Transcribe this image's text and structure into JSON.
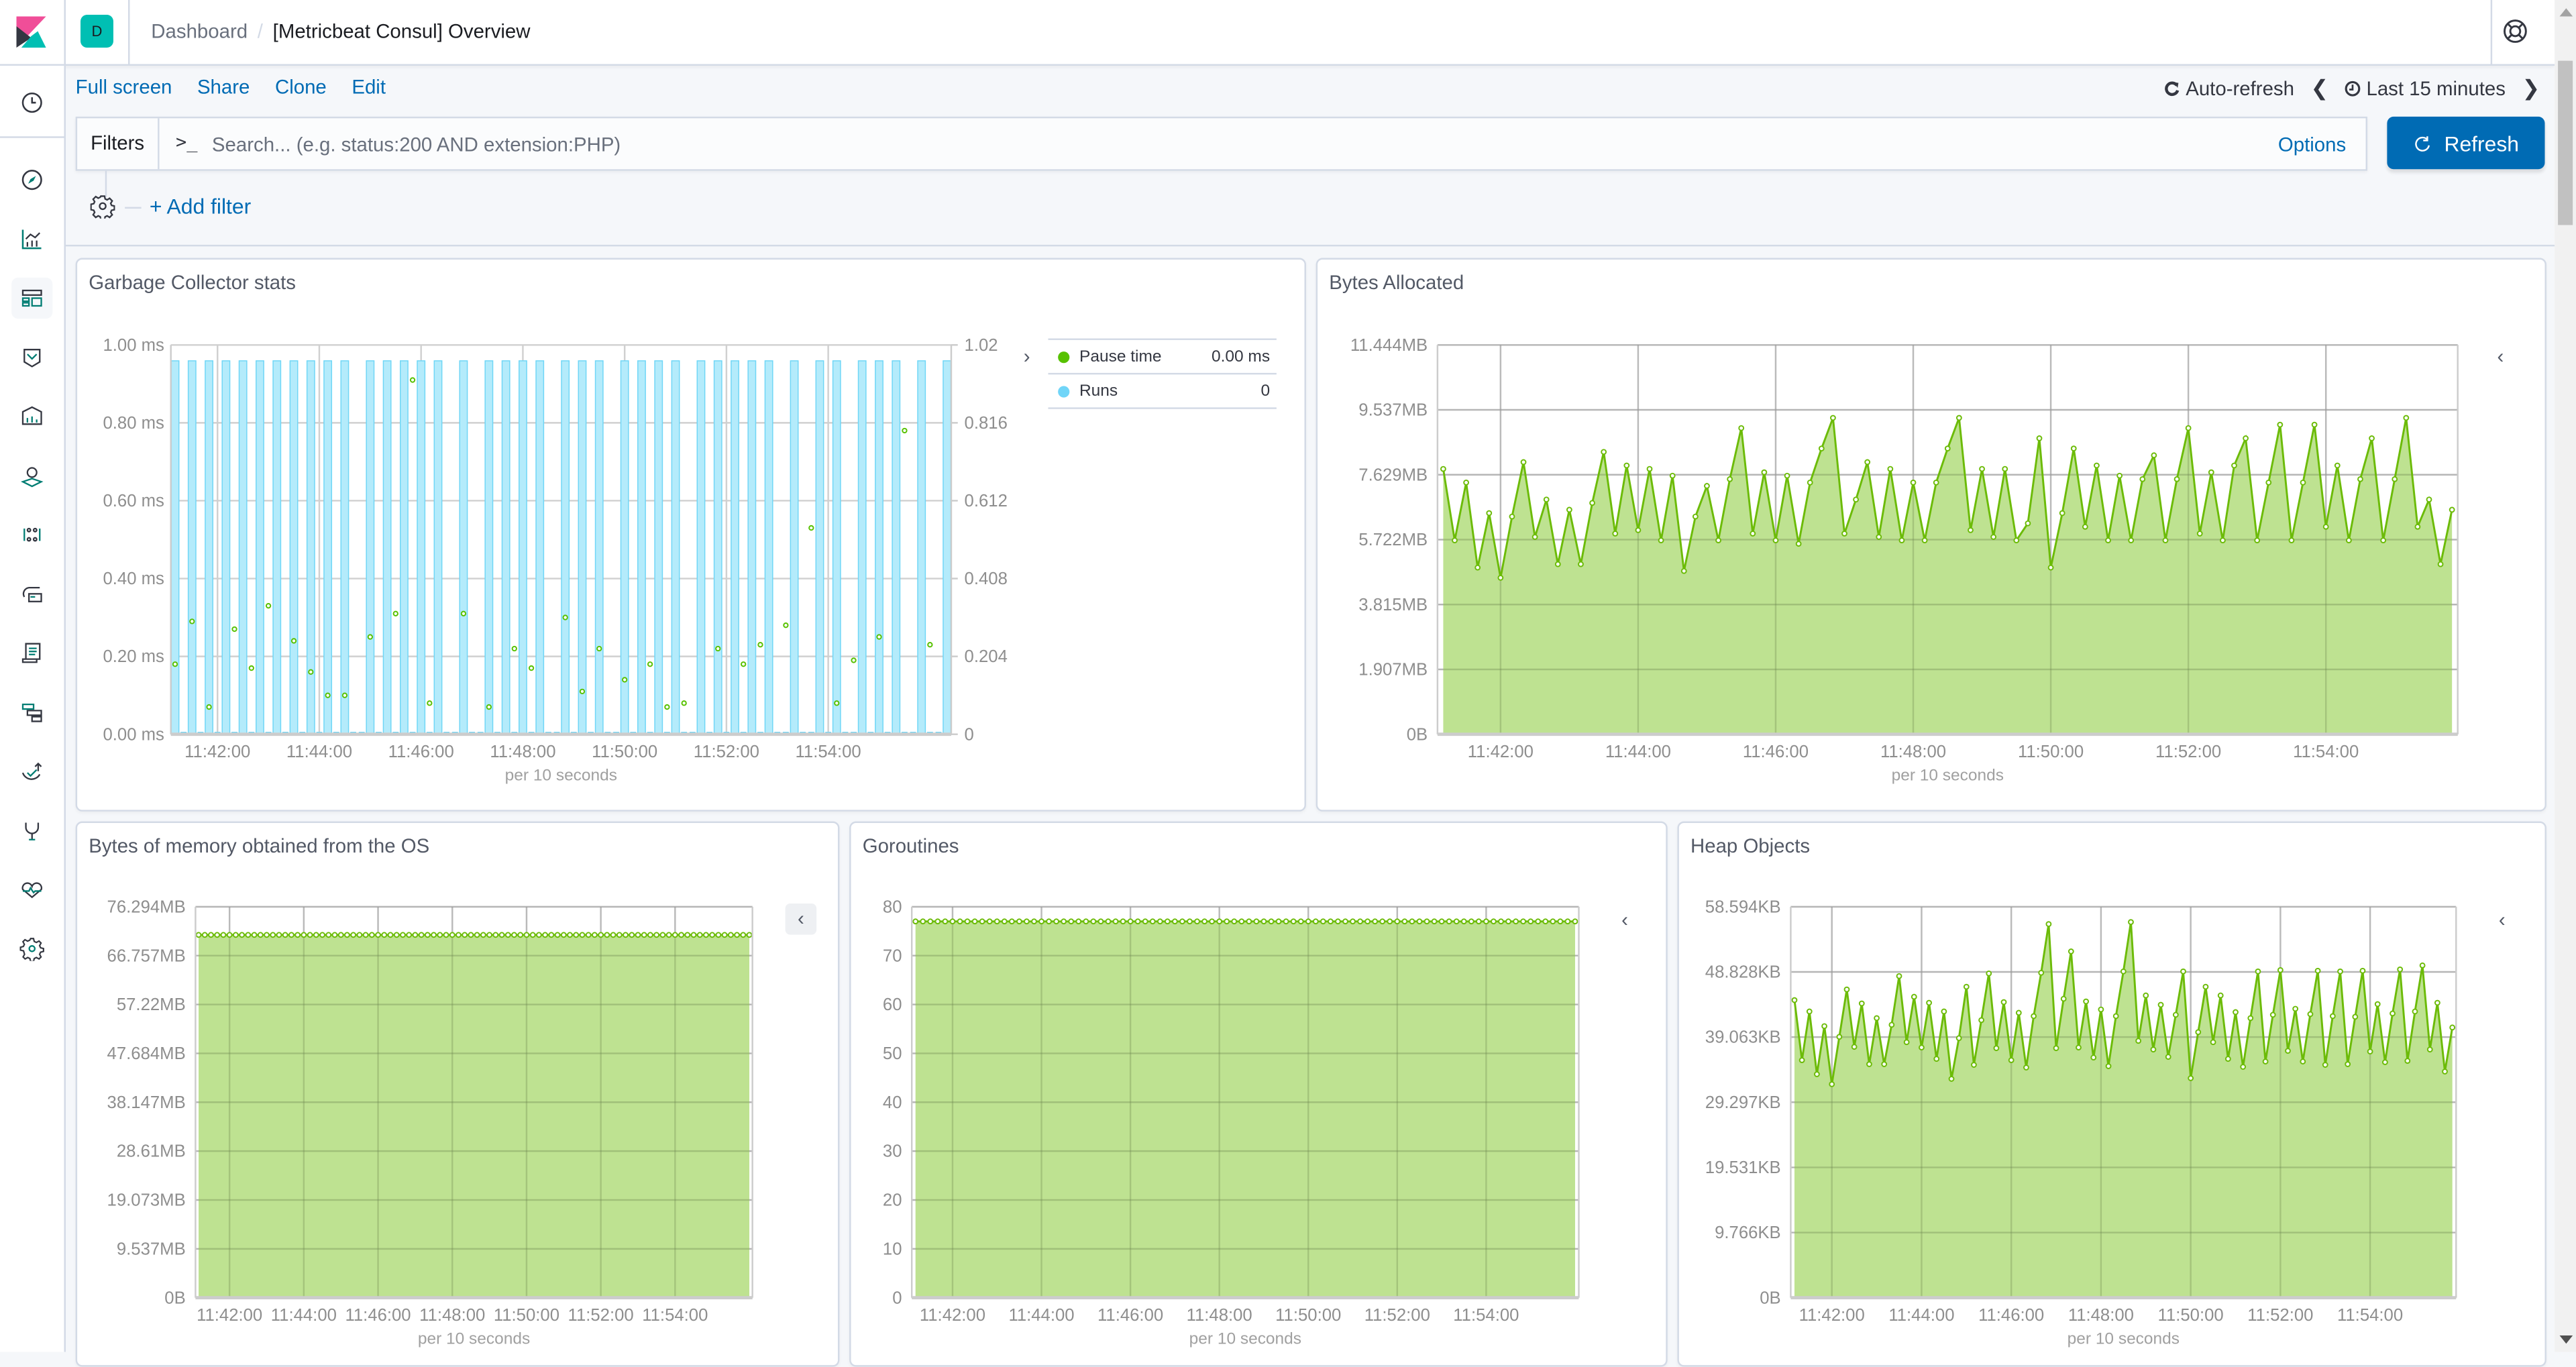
{
  "header": {
    "space_initial": "D",
    "breadcrumb_root": "Dashboard",
    "breadcrumb_current": "[Metricbeat Consul] Overview",
    "help_icon": "lifebuoy-icon"
  },
  "sidenav": {
    "items": [
      {
        "name": "recently-viewed",
        "icon": "clock-icon"
      },
      {
        "name": "discover",
        "icon": "compass-icon"
      },
      {
        "name": "visualize",
        "icon": "chart-icon"
      },
      {
        "name": "dashboard",
        "icon": "dashboard-icon",
        "active": true
      },
      {
        "name": "canvas",
        "icon": "canvas-icon"
      },
      {
        "name": "timelion",
        "icon": "timelion-icon"
      },
      {
        "name": "maps",
        "icon": "map-icon"
      },
      {
        "name": "ml",
        "icon": "machine-learning-icon"
      },
      {
        "name": "infrastructure",
        "icon": "infra-icon"
      },
      {
        "name": "logs",
        "icon": "logs-icon"
      },
      {
        "name": "apm",
        "icon": "apm-icon"
      },
      {
        "name": "uptime",
        "icon": "uptime-icon"
      },
      {
        "name": "dev-tools",
        "icon": "wrench-icon"
      },
      {
        "name": "monitoring",
        "icon": "heartbeat-icon"
      },
      {
        "name": "management",
        "icon": "gear-icon"
      }
    ]
  },
  "menu": {
    "full_screen": "Full screen",
    "share": "Share",
    "clone": "Clone",
    "edit": "Edit"
  },
  "time": {
    "auto_refresh": "Auto-refresh",
    "range": "Last 15 minutes"
  },
  "query": {
    "filters_label": "Filters",
    "prompt": ">_",
    "placeholder": "Search... (e.g. status:200 AND extension:PHP)",
    "value": "",
    "options": "Options",
    "refresh": "Refresh"
  },
  "filter_bar": {
    "add_filter": "+ Add filter"
  },
  "colors": {
    "accent": "#006bb4",
    "area_fill": "#b3dd7e",
    "area_line": "#6cbb08",
    "runs_bar": "#b4ebfb",
    "runs_bar_stroke": "#6fd6f6"
  },
  "chart_data": [
    {
      "id": "gc",
      "title": "Garbage Collector stats",
      "type": "bar",
      "xlabel": "per 10 seconds",
      "x_ticks": [
        "11:42:00",
        "11:44:00",
        "11:46:00",
        "11:48:00",
        "11:50:00",
        "11:52:00",
        "11:54:00"
      ],
      "y_left_ticks": [
        "0.00 ms",
        "0.20 ms",
        "0.40 ms",
        "0.60 ms",
        "0.80 ms",
        "1.00 ms"
      ],
      "y_left_range": [
        0,
        1.0
      ],
      "y_right_ticks": [
        "0",
        "0.204",
        "0.408",
        "0.612",
        "0.816",
        "1.02"
      ],
      "y_right_range": [
        0,
        1.02
      ],
      "legend": [
        {
          "label": "Pause time",
          "value": "0.00 ms",
          "color": "#57c100"
        },
        {
          "label": "Runs",
          "value": "0",
          "color": "#70d5f8"
        }
      ],
      "series": [
        {
          "name": "Runs",
          "type": "bar",
          "axis": "right",
          "values": [
            1,
            0,
            1,
            0,
            1,
            0,
            1,
            0,
            1,
            0,
            1,
            0,
            1,
            0,
            1,
            0,
            1,
            0,
            1,
            0,
            1,
            0,
            0,
            1,
            0,
            1,
            0,
            1,
            0,
            1,
            0,
            1,
            0,
            0,
            1,
            0,
            0,
            1,
            0,
            1,
            0,
            1,
            0,
            1,
            0,
            0,
            1,
            0,
            1,
            0,
            1,
            0,
            0,
            1,
            0,
            1,
            0,
            1,
            0,
            1,
            0,
            0,
            1,
            0,
            1,
            0,
            1,
            0,
            1,
            0,
            1,
            0,
            0,
            1,
            0,
            0,
            1,
            0,
            1,
            0,
            0,
            1,
            0,
            1,
            0,
            1,
            0,
            0,
            1,
            0,
            0,
            1
          ]
        },
        {
          "name": "Pause time",
          "type": "scatter",
          "axis": "left",
          "points": [
            [
              0,
              0.18
            ],
            [
              2,
              0.29
            ],
            [
              4,
              0.07
            ],
            [
              7,
              0.27
            ],
            [
              9,
              0.17
            ],
            [
              11,
              0.33
            ],
            [
              14,
              0.24
            ],
            [
              16,
              0.16
            ],
            [
              18,
              0.1
            ],
            [
              20,
              0.1
            ],
            [
              23,
              0.25
            ],
            [
              26,
              0.31
            ],
            [
              28,
              0.91
            ],
            [
              30,
              0.08
            ],
            [
              34,
              0.31
            ],
            [
              37,
              0.07
            ],
            [
              40,
              0.22
            ],
            [
              42,
              0.17
            ],
            [
              46,
              0.3
            ],
            [
              48,
              0.11
            ],
            [
              50,
              0.22
            ],
            [
              53,
              0.14
            ],
            [
              56,
              0.18
            ],
            [
              58,
              0.07
            ],
            [
              60,
              0.08
            ],
            [
              64,
              0.22
            ],
            [
              67,
              0.18
            ],
            [
              69,
              0.23
            ],
            [
              72,
              0.28
            ],
            [
              75,
              0.53
            ],
            [
              78,
              0.08
            ],
            [
              80,
              0.19
            ],
            [
              83,
              0.25
            ],
            [
              86,
              0.78
            ],
            [
              89,
              0.23
            ]
          ]
        }
      ]
    },
    {
      "id": "bytes-allocated",
      "title": "Bytes Allocated",
      "type": "area",
      "xlabel": "per 10 seconds",
      "x_ticks": [
        "11:42:00",
        "11:44:00",
        "11:46:00",
        "11:48:00",
        "11:50:00",
        "11:52:00",
        "11:54:00"
      ],
      "y_ticks": [
        "0B",
        "1.907MB",
        "3.815MB",
        "5.722MB",
        "7.629MB",
        "9.537MB",
        "11.444MB"
      ],
      "y_range_mb": [
        0,
        11.444
      ],
      "values_mb": [
        7.8,
        5.7,
        7.4,
        4.9,
        6.5,
        4.6,
        6.4,
        8.0,
        5.8,
        6.9,
        5.0,
        6.6,
        5.0,
        6.8,
        8.3,
        5.9,
        7.9,
        6.0,
        7.8,
        5.7,
        7.6,
        4.8,
        6.4,
        7.3,
        5.7,
        7.5,
        9.0,
        5.9,
        7.7,
        5.7,
        7.6,
        5.6,
        7.4,
        8.4,
        9.3,
        5.9,
        6.9,
        8.0,
        5.8,
        7.8,
        5.7,
        7.4,
        5.7,
        7.4,
        8.4,
        9.3,
        6.0,
        7.8,
        5.8,
        7.8,
        5.7,
        6.2,
        8.7,
        4.9,
        6.5,
        8.4,
        6.1,
        7.9,
        5.7,
        7.6,
        5.7,
        7.5,
        8.2,
        5.7,
        7.5,
        9.0,
        5.9,
        7.7,
        5.7,
        7.9,
        8.7,
        5.7,
        7.4,
        9.1,
        5.7,
        7.4,
        9.1,
        6.1,
        7.9,
        5.7,
        7.5,
        8.7,
        5.7,
        7.5,
        9.3,
        6.1,
        6.9,
        5.0,
        6.6
      ]
    },
    {
      "id": "bytes-os",
      "title": "Bytes of memory obtained from the OS",
      "type": "area",
      "xlabel": "per 10 seconds",
      "x_ticks": [
        "11:42:00",
        "11:44:00",
        "11:46:00",
        "11:48:00",
        "11:50:00",
        "11:52:00",
        "11:54:00"
      ],
      "y_ticks": [
        "0B",
        "9.537MB",
        "19.073MB",
        "28.61MB",
        "38.147MB",
        "47.684MB",
        "57.22MB",
        "66.757MB",
        "76.294MB"
      ],
      "y_range_mb": [
        0,
        76.294
      ],
      "constant_value_mb": 70.8,
      "point_count": 90
    },
    {
      "id": "goroutines",
      "title": "Goroutines",
      "type": "area",
      "xlabel": "per 10 seconds",
      "x_ticks": [
        "11:42:00",
        "11:44:00",
        "11:46:00",
        "11:48:00",
        "11:50:00",
        "11:52:00",
        "11:54:00"
      ],
      "y_ticks": [
        "0",
        "10",
        "20",
        "30",
        "40",
        "50",
        "60",
        "70",
        "80"
      ],
      "y_range": [
        0,
        80
      ],
      "constant_value": 77,
      "point_count": 90
    },
    {
      "id": "heap-objects",
      "title": "Heap Objects",
      "type": "area",
      "xlabel": "per 10 seconds",
      "x_ticks": [
        "11:42:00",
        "11:44:00",
        "11:46:00",
        "11:48:00",
        "11:50:00",
        "11:52:00",
        "11:54:00"
      ],
      "y_ticks": [
        "0B",
        "9.766KB",
        "19.531KB",
        "29.297KB",
        "39.063KB",
        "48.828KB",
        "58.594KB"
      ],
      "y_range_kb": [
        0,
        58.594
      ],
      "values_kb": [
        44.6,
        35.6,
        42.9,
        33.5,
        40.7,
        32.0,
        39.1,
        46.2,
        37.6,
        44.1,
        35.0,
        41.9,
        35.0,
        40.9,
        48.2,
        38.3,
        45.1,
        37.5,
        44.2,
        35.8,
        42.9,
        32.8,
        38.9,
        46.6,
        34.9,
        41.6,
        48.6,
        37.4,
        44.3,
        35.6,
        42.7,
        34.5,
        42.2,
        48.7,
        56.0,
        37.4,
        44.8,
        51.9,
        37.5,
        44.4,
        36.0,
        43.2,
        34.7,
        42.2,
        48.9,
        56.3,
        38.5,
        45.3,
        37.2,
        43.9,
        36.1,
        42.4,
        48.9,
        32.9,
        39.8,
        46.6,
        38.3,
        45.3,
        35.8,
        42.8,
        34.6,
        41.9,
        48.9,
        35.4,
        42.4,
        49.1,
        37.0,
        43.3,
        35.4,
        42.5,
        49.0,
        34.9,
        42.2,
        48.9,
        35.0,
        42.1,
        49.0,
        36.9,
        44.0,
        35.3,
        42.6,
        49.2,
        35.5,
        42.9,
        49.8,
        37.2,
        44.2,
        33.9,
        40.5
      ]
    }
  ]
}
